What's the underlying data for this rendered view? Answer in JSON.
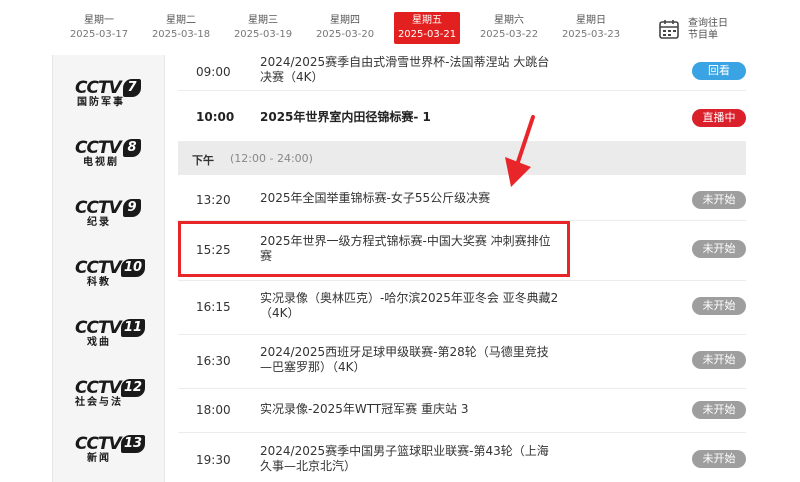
{
  "week": [
    {
      "weekday": "星期一",
      "date": "2025-03-17"
    },
    {
      "weekday": "星期二",
      "date": "2025-03-18"
    },
    {
      "weekday": "星期三",
      "date": "2025-03-19"
    },
    {
      "weekday": "星期四",
      "date": "2025-03-20"
    },
    {
      "weekday": "星期五",
      "date": "2025-03-21"
    },
    {
      "weekday": "星期六",
      "date": "2025-03-22"
    },
    {
      "weekday": "星期日",
      "date": "2025-03-23"
    }
  ],
  "selected_day": "星期五",
  "history": {
    "line1": "查询往日",
    "line2": "节目单",
    "icon": "calendar-icon"
  },
  "channels": [
    {
      "brand": "CCTV",
      "num": "7",
      "name": "国防军事"
    },
    {
      "brand": "CCTV",
      "num": "8",
      "name": "电视剧"
    },
    {
      "brand": "CCTV",
      "num": "9",
      "name": "纪录"
    },
    {
      "brand": "CCTV",
      "num": "10",
      "name": "科教"
    },
    {
      "brand": "CCTV",
      "num": "11",
      "name": "戏曲"
    },
    {
      "brand": "CCTV",
      "num": "12",
      "name": "社会与法"
    },
    {
      "brand": "CCTV",
      "num": "13",
      "name": "新闻"
    }
  ],
  "section": {
    "label": "下午",
    "range": "(12:00 - 24:00)"
  },
  "programs": [
    {
      "time": "09:00",
      "title": "2024/2025赛季自由式滑雪世界杯-法国蒂涅站 大跳台决赛（4K）",
      "status": "回看"
    },
    {
      "time": "10:00",
      "title": "2025年世界室内田径锦标赛- 1",
      "status": "直播中"
    },
    {
      "time": "13:20",
      "title": "2025年全国举重锦标赛-女子55公斤级决赛",
      "status": "未开始"
    },
    {
      "time": "15:25",
      "title": "2025年世界一级方程式锦标赛-中国大奖赛 冲刺赛排位赛",
      "status": "未开始"
    },
    {
      "time": "16:15",
      "title": "实况录像（奥林匹克）-哈尔滨2025年亚冬会 亚冬典藏2（4K）",
      "status": "未开始"
    },
    {
      "time": "16:30",
      "title": "2024/2025西班牙足球甲级联赛-第28轮（马德里竞技—巴塞罗那）（4K）",
      "status": "未开始"
    },
    {
      "time": "18:00",
      "title": "实况录像-2025年WTT冠军赛 重庆站 3",
      "status": "未开始"
    },
    {
      "time": "19:30",
      "title": "2024/2025赛季中国男子篮球职业联赛-第43轮（上海久事—北京北汽）",
      "status": "未开始"
    }
  ],
  "colors": {
    "accent_red": "#e1201f",
    "replay_blue": "#3aa3e3",
    "live_red": "#d9202b",
    "upcoming_gray": "#9e9e9e"
  }
}
